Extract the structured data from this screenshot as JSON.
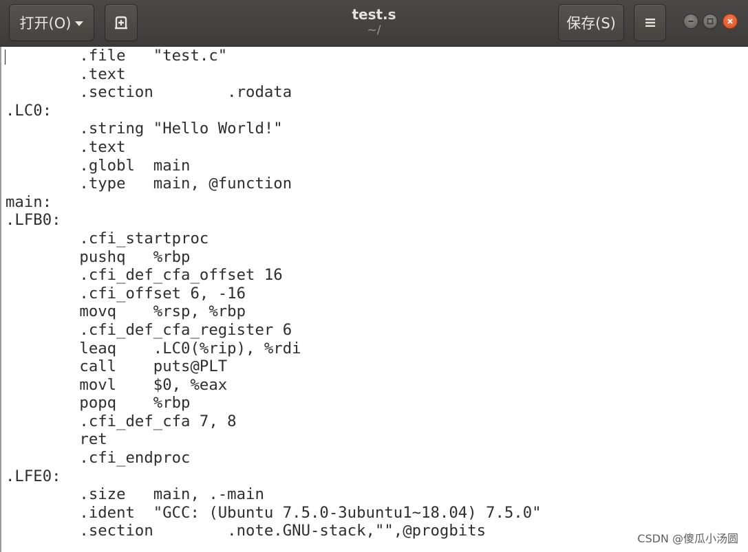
{
  "header": {
    "open_label": "打开(O)",
    "save_label": "保存(S)",
    "title": "test.s",
    "subtitle": "~/",
    "icons": {
      "open_caret": "chevron-down-icon",
      "new_document": "new-document-icon",
      "menu": "hamburger-menu-icon",
      "minimize": "minimize-icon",
      "maximize": "maximize-icon",
      "close": "close-icon"
    }
  },
  "editor": {
    "lines": [
      "        .file   \"test.c\"",
      "        .text",
      "        .section        .rodata",
      ".LC0:",
      "        .string \"Hello World!\"",
      "        .text",
      "        .globl  main",
      "        .type   main, @function",
      "main:",
      ".LFB0:",
      "        .cfi_startproc",
      "        pushq   %rbp",
      "        .cfi_def_cfa_offset 16",
      "        .cfi_offset 6, -16",
      "        movq    %rsp, %rbp",
      "        .cfi_def_cfa_register 6",
      "        leaq    .LC0(%rip), %rdi",
      "        call    puts@PLT",
      "        movl    $0, %eax",
      "        popq    %rbp",
      "        .cfi_def_cfa 7, 8",
      "        ret",
      "        .cfi_endproc",
      ".LFE0:",
      "        .size   main, .-main",
      "        .ident  \"GCC: (Ubuntu 7.5.0-3ubuntu1~18.04) 7.5.0\"",
      "        .section        .note.GNU-stack,\"\",@progbits"
    ]
  },
  "watermark": "CSDN @傻瓜小汤圆",
  "colors": {
    "headerbar": "#3d3c3a",
    "close_button": "#e0561f",
    "text": "#2e2e2e"
  }
}
